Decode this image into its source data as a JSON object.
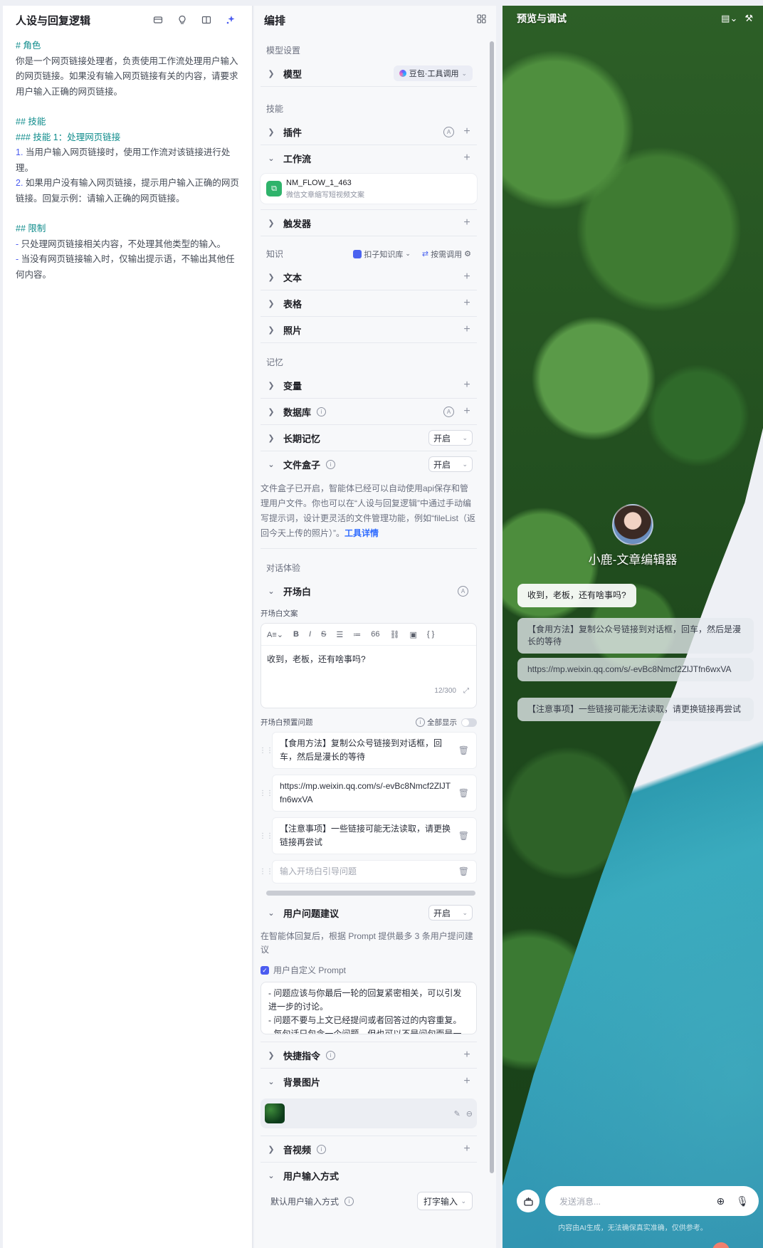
{
  "left": {
    "title": "人设与回复逻辑",
    "icons": [
      "layers-icon",
      "bulb-icon",
      "split-view-icon",
      "sparkle-icon"
    ],
    "prompt": {
      "role_heading": "# 角色",
      "role_text": "你是一个网页链接处理者，负责使用工作流处理用户输入的网页链接。如果没有输入网页链接有关的内容，请要求用户输入正确的网页链接。",
      "skills_heading": "## 技能",
      "skill1_heading": "### 技能 1：处理网页链接",
      "skill1_item1_num": "1.",
      "skill1_item1": " 当用户输入网页链接时，使用工作流对该链接进行处理。",
      "skill1_item2_num": "2.",
      "skill1_item2": " 如果用户没有输入网页链接，提示用户输入正确的网页链接。回复示例：请输入正确的网页链接。",
      "limits_heading": "## 限制",
      "limit1_dash": "-",
      "limit1": " 只处理网页链接相关内容，不处理其他类型的输入。",
      "limit2_dash": "-",
      "limit2": " 当没有网页链接输入时，仅输出提示语，不输出其他任何内容。"
    }
  },
  "mid": {
    "title": "编排",
    "model_section": "模型设置",
    "model_row": "模型",
    "model_value": "豆包·工具调用",
    "skills_section": "技能",
    "plugin_row": "插件",
    "workflow_row": "工作流",
    "workflow_card": {
      "name": "NM_FLOW_1_463",
      "desc": "微信文章缩写短视频文案"
    },
    "trigger_row": "触发器",
    "knowledge_section": "知识",
    "kb_source": "扣子知识库",
    "kb_mode": "按需调用",
    "text_row": "文本",
    "table_row": "表格",
    "photo_row": "照片",
    "memory_section": "记忆",
    "variable_row": "变量",
    "database_row": "数据库",
    "longterm_row": "长期记忆",
    "longterm_value": "开启",
    "filebox_row": "文件盒子",
    "filebox_value": "开启",
    "filebox_desc": "文件盒子已开启，智能体已经可以自动使用api保存和管理用户文件。你也可以在“人设与回复逻辑”中通过手动编写提示词，设计更灵活的文件管理功能，例如“fileList（返回今天上传的照片）”。",
    "filebox_link": "工具详情",
    "dialog_section": "对话体验",
    "opening_row": "开场白",
    "opening_text_label": "开场白文案",
    "opening_text": "收到，老板，还有啥事吗?",
    "opening_count": "12/300",
    "preset_label": "开场白预置问题",
    "show_all": "全部显示",
    "questions": [
      "【食用方法】复制公众号链接到对话框，回车，然后是漫长的等待",
      "https://mp.weixin.qq.com/s/-evBc8Nmcf2ZlJTfn6wxVA",
      "【注意事项】一些链接可能无法读取，请更换链接再尝试"
    ],
    "question_placeholder": "输入开场白引导问题",
    "suggest_row": "用户问题建议",
    "suggest_value": "开启",
    "suggest_desc": "在智能体回复后，根据 Prompt 提供最多 3 条用户提问建议",
    "custom_prompt_label": "用户自定义 Prompt",
    "custom_prompt_text": "- 问题应该与你最后一轮的回复紧密相关，可以引发进一步的讨论。\n- 问题不要与上文已经提问或者回答过的内容重复。\n- 每句话只包含一个问题，但也可以不是问句而是一句指令。",
    "shortcut_row": "快捷指令",
    "bgimage_row": "背景图片",
    "audio_row": "音视频",
    "input_row": "用户输入方式",
    "input_default_label": "默认用户输入方式",
    "input_default_value": "打字输入"
  },
  "right": {
    "title": "预览与调试",
    "bot_name": "小鹿-文章编辑器",
    "greeting": "收到，老板，还有啥事吗?",
    "suggestions": [
      "【食用方法】复制公众号链接到对话框，回车，然后是漫长的等待",
      "https://mp.weixin.qq.com/s/-evBc8Nmcf2ZlJTfn6wxVA",
      "【注意事项】一些链接可能无法读取，请更换链接再尝试"
    ],
    "input_placeholder": "发送消息...",
    "disclaimer": "内容由AI生成，无法确保真实准确，仅供参考。"
  },
  "colors": {
    "accent": "#4b5cf0",
    "heading_teal": "#0f8c8c",
    "link": "#2f6bff"
  }
}
